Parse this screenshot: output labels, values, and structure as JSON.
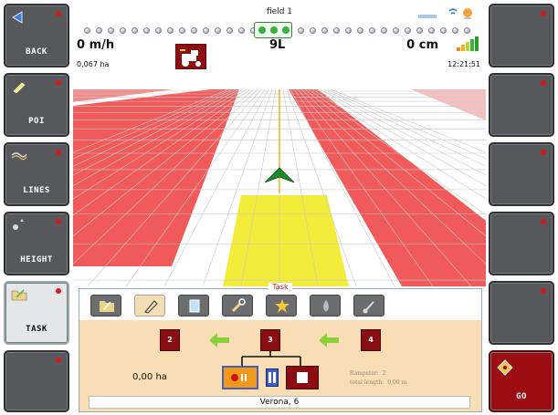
{
  "left_buttons": [
    {
      "label": "BACK",
      "icon": "back-arrow-icon"
    },
    {
      "label": "POI",
      "icon": "pencil-poi-icon"
    },
    {
      "label": "LINES",
      "icon": "lines-icon"
    },
    {
      "label": "HEIGHT",
      "icon": "height-icon"
    },
    {
      "label": "TASK",
      "icon": "task-folder-icon",
      "active": true
    },
    {
      "label": "",
      "icon": ""
    }
  ],
  "right_buttons": [
    {
      "label": ""
    },
    {
      "label": ""
    },
    {
      "label": ""
    },
    {
      "label": ""
    },
    {
      "label": ""
    },
    {
      "label": "GO",
      "icon": "go-diamond-icon"
    }
  ],
  "status_bar": {
    "field_name": "field 1",
    "speed": "0 m/h",
    "area": "0,067 ha",
    "lane": "9L",
    "offset": "0 cm",
    "time": "12:21:51"
  },
  "task": {
    "title": "Task",
    "tabs": [
      "folder",
      "pencil",
      "notepad",
      "wrench",
      "star",
      "drop",
      "shovel"
    ],
    "selected_tab": 1,
    "steps": [
      "2",
      "3",
      "4"
    ],
    "area": "0,00 ha",
    "stats_label_1": "Rampster:",
    "stats_value_1": "2",
    "stats_label_2": "total length:",
    "stats_value_2": "0,00 m",
    "location": "Verona, 6"
  },
  "colors": {
    "button_gray": "#56585b",
    "go_red": "#9c0d12",
    "field_red": "#f05a5a",
    "worked_yellow": "#f4ec3a",
    "guide_green": "#1d8b2a",
    "panel_beige": "#f9ddb4"
  }
}
